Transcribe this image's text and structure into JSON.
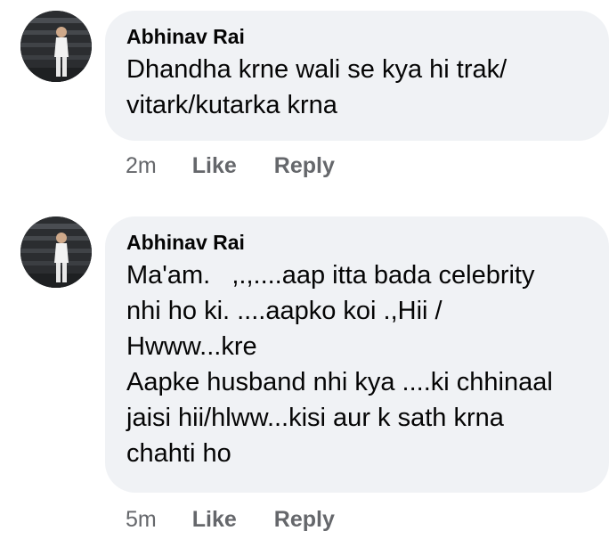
{
  "comments": [
    {
      "author": "Abhinav Rai",
      "lines": [
        "Dhandha krne wali se kya hi trak/",
        "vitark/kutarka krna"
      ],
      "time": "2m",
      "like_label": "Like",
      "reply_label": "Reply"
    },
    {
      "author": "Abhinav Rai",
      "lines": [
        "Ma'am.   ,.,....aap itta bada celebrity",
        "nhi ho ki. ....aapko koi .,Hii /",
        "Hwww...kre",
        "Aapke husband nhi kya ....ki chhinaal",
        "jaisi hii/hlww...kisi aur k sath krna",
        "chahti ho"
      ],
      "time": "5m",
      "like_label": "Like",
      "reply_label": "Reply"
    }
  ]
}
